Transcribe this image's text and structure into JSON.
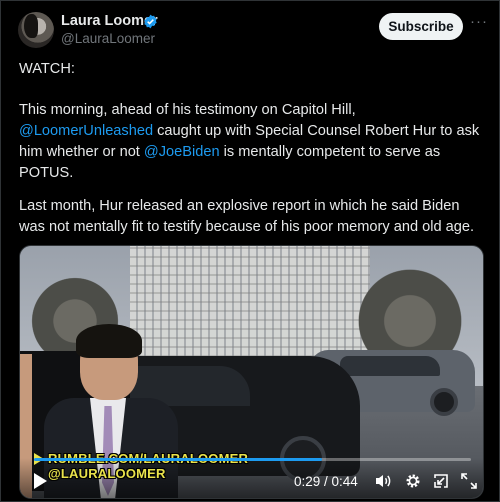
{
  "author": {
    "name": "Laura Loomer",
    "handle": "@LauraLoomer",
    "verified": true
  },
  "actions": {
    "subscribe_label": "Subscribe",
    "more_label": "···"
  },
  "tweet": {
    "line_watch": "WATCH:",
    "p2_before": "This morning, ahead of his testimony on Capitol Hill,",
    "p2_mention1": "@LoomerUnleashed",
    "p2_middle": " caught up with Special Counsel Robert Hur to ask him whether or not ",
    "p2_mention2": "@JoeBiden",
    "p2_after": " is mentally competent to serve as POTUS.",
    "p3": "Last month, Hur released an explosive report in which he said Biden was not mentally fit to testify because of his poor memory and old age."
  },
  "video": {
    "watermark_line1": "RUMBLE.COM/LAURALOOMER",
    "watermark_line2": "@LAURALOOMER",
    "time": "0:29 / 0:44",
    "progress": 0.66,
    "controls": [
      "play-icon",
      "volume-icon",
      "settings-icon",
      "exit-icon",
      "fullscreen-icon"
    ]
  },
  "colors": {
    "accent": "#1d9bf0",
    "background": "#000000",
    "text": "#e7e9ea",
    "muted": "#71767b",
    "watermark": "#e9e24b"
  }
}
